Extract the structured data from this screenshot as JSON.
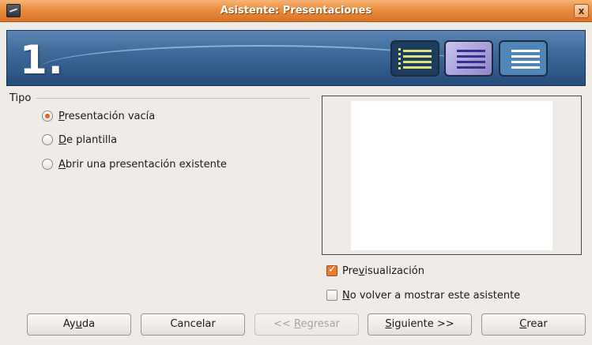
{
  "window": {
    "title": "Asistente: Presentaciones",
    "close_label": "x"
  },
  "banner": {
    "step": "1."
  },
  "type_group": {
    "label": "Tipo",
    "options": [
      {
        "prefix": "",
        "mnemonic": "P",
        "rest": "resentación vacía",
        "checked": true
      },
      {
        "prefix": "",
        "mnemonic": "D",
        "rest": "e plantilla",
        "checked": false
      },
      {
        "prefix": "",
        "mnemonic": "A",
        "rest": "brir una presentación existente",
        "checked": false
      }
    ]
  },
  "preview": {
    "checkbox_prefix": "Pre",
    "checkbox_mnemonic": "v",
    "checkbox_rest": "isualización",
    "checked": true
  },
  "no_show": {
    "mnemonic": "N",
    "rest": "o volver a mostrar este asistente",
    "checked": false
  },
  "buttons": {
    "help_prefix": "Ay",
    "help_mnemonic": "u",
    "help_rest": "da",
    "cancel": "Cancelar",
    "back_prefix": "<< ",
    "back_mnemonic": "R",
    "back_rest": "egresar",
    "next_mnemonic": "S",
    "next_rest": "iguiente >>",
    "create_mnemonic": "C",
    "create_rest": "rear"
  },
  "colors": {
    "titlebar": "#e98d3f",
    "accent": "#e2661d",
    "banner": "#3e6a99"
  }
}
